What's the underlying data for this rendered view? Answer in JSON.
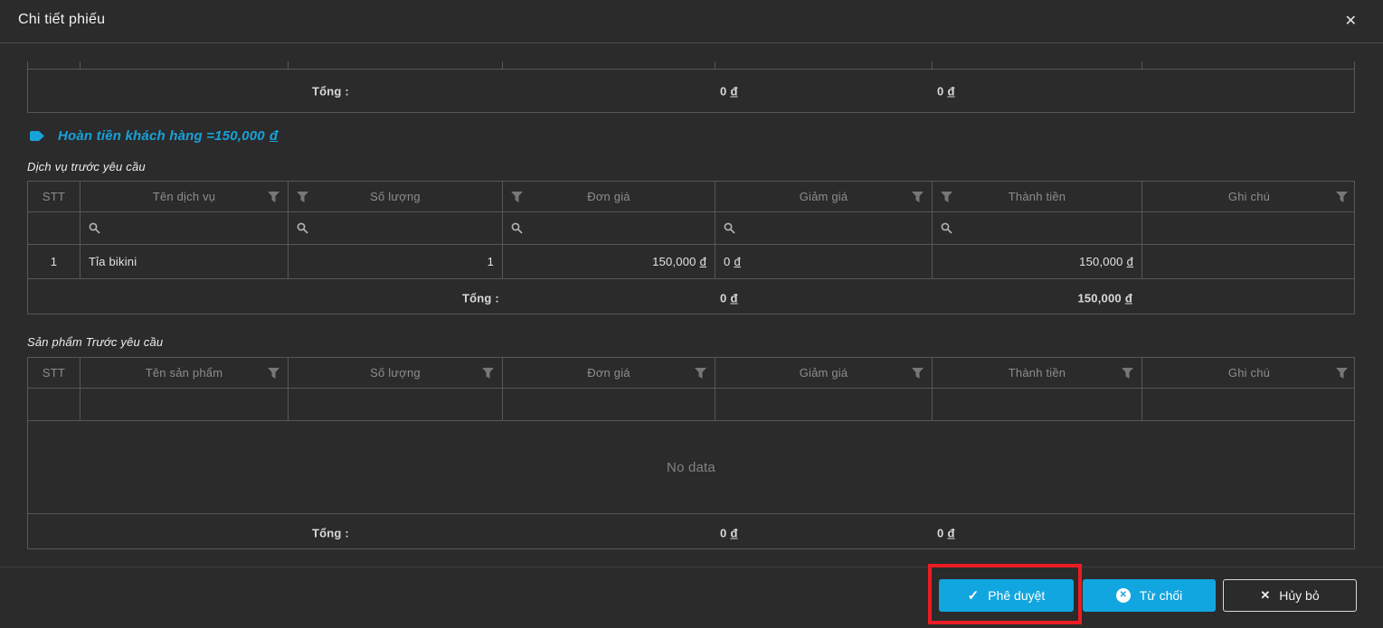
{
  "modal": {
    "title": "Chi tiết phiếu"
  },
  "icons": {
    "close": "✕",
    "check": "✓",
    "reject_x": "✕",
    "cancel_x": "✕"
  },
  "currency": "đ",
  "summary_table": {
    "total_label": "Tổng :",
    "discount_total": "0",
    "amount_total": "0"
  },
  "refund_note": {
    "text": "Hoàn tiền khách hàng =150,000"
  },
  "service_section": {
    "caption": "Dịch vụ trước yêu cầu",
    "columns": [
      "STT",
      "Tên dịch vụ",
      "Số lượng",
      "Đơn giá",
      "Giảm giá",
      "Thành tiền",
      "Ghi chú"
    ],
    "row": {
      "stt": "1",
      "name": "Tỉa bikini",
      "qty": "1",
      "price": "150,000",
      "discount": "0",
      "amount": "150,000",
      "note": ""
    },
    "total_label": "Tổng :",
    "discount_total": "0",
    "amount_total": "150,000"
  },
  "product_section": {
    "caption": "Sản phẩm Trước yêu cầu",
    "columns": [
      "STT",
      "Tên sản phẩm",
      "Số lượng",
      "Đơn giá",
      "Giảm giá",
      "Thành tiền",
      "Ghi chú"
    ],
    "empty_text": "No data",
    "total_label": "Tổng :",
    "discount_total": "0",
    "amount_total": "0"
  },
  "footer": {
    "approve": "Phê duyệt",
    "reject": "Từ chối",
    "cancel": "Hủy bỏ"
  },
  "colors": {
    "background": "#2b2b2b",
    "table_border": "#575757",
    "accent_cyan": "#12a6e0",
    "annotation_red": "#ec1c24"
  }
}
